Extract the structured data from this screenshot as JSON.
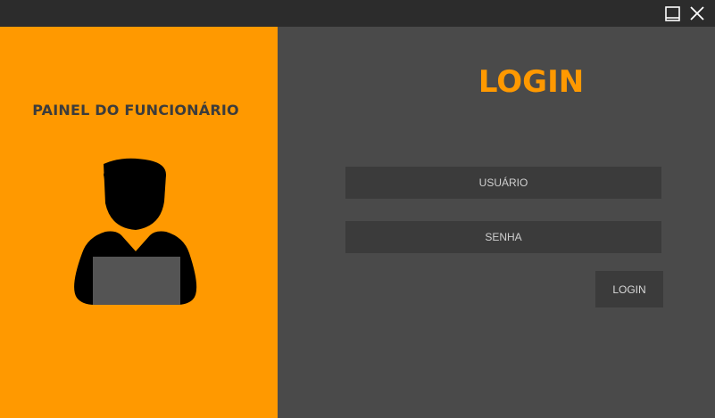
{
  "window": {
    "controls": {
      "maximize_icon": "maximize-icon",
      "close_icon": "close-icon"
    }
  },
  "left_panel": {
    "title": "PAINEL DO FUNCIONÁRIO",
    "illustration_icon": "employee-with-laptop-icon"
  },
  "login_form": {
    "title": "LOGIN",
    "username_placeholder": "USUÁRIO",
    "password_placeholder": "SENHA",
    "submit_label": "LOGIN"
  },
  "colors": {
    "accent": "#ff9900",
    "titlebar": "#2c2c2c",
    "panel_bg": "#4a4a4a",
    "field_bg": "#3b3b3b",
    "heading_dark": "#3c3c3c"
  }
}
